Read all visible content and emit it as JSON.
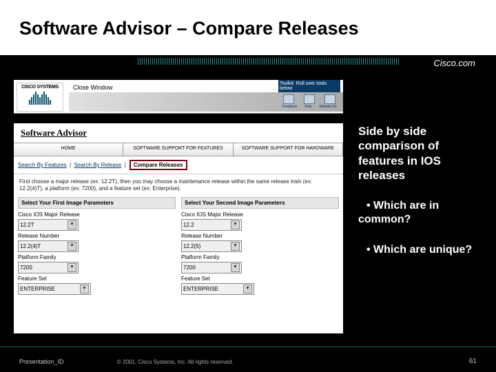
{
  "slide": {
    "title": "Software Advisor – Compare Releases",
    "cisco_com": "Cisco.com",
    "right": {
      "main": "Side by side comparison of features in IOS releases",
      "b1": "• Which are in common?",
      "b2": "• Which are unique?"
    },
    "footer": {
      "pid": "Presentation_ID",
      "copyright": "© 2001, Cisco Systems, Inc. All rights reserved.",
      "page": "61"
    }
  },
  "shot": {
    "logo_text": "CISCO SYSTEMS",
    "close_window": "Close Window",
    "toolkit": {
      "label": "Toolkit: Roll over tools below",
      "l1": "Feedback",
      "l2": "Help",
      "l3": "Website Fn"
    },
    "breadcrumb": "Software Advisor",
    "tabs": {
      "t1": "HOME",
      "t2": "SOFTWARE SUPPORT FOR FEATURES",
      "t3": "SOFTWARE SUPPORT FOR HARDWARE"
    },
    "subnav": {
      "a1": "Search By Features",
      "a2": "Search By Release",
      "current": "Compare Releases"
    },
    "instructions": "First choose a major release (ex: 12.2T), then you may choose a maintenance release within the same release train (ex: 12.2(4)T), a platform (ex: 7200), and a feature set (ex: Enterprise).",
    "col1": {
      "header": "Select Your First Image Parameters",
      "major_lbl": "Cisco IOS Major Release",
      "major_val": "12.2T",
      "rel_lbl": "Release Number",
      "rel_val": "12.2(4)T",
      "plat_lbl": "Platform Family",
      "plat_val": "7200",
      "fs_lbl": "Feature Set",
      "fs_val": "ENTERPRISE"
    },
    "col2": {
      "header": "Select Your Second Image Parameters",
      "major_lbl": "Cisco IOS Major Release",
      "major_val": "12.2",
      "rel_lbl": "Release Number",
      "rel_val": "12.2(5)",
      "plat_lbl": "Platform Family",
      "plat_val": "7200",
      "fs_lbl": "Feature Set",
      "fs_val": "ENTERPRISE"
    }
  }
}
